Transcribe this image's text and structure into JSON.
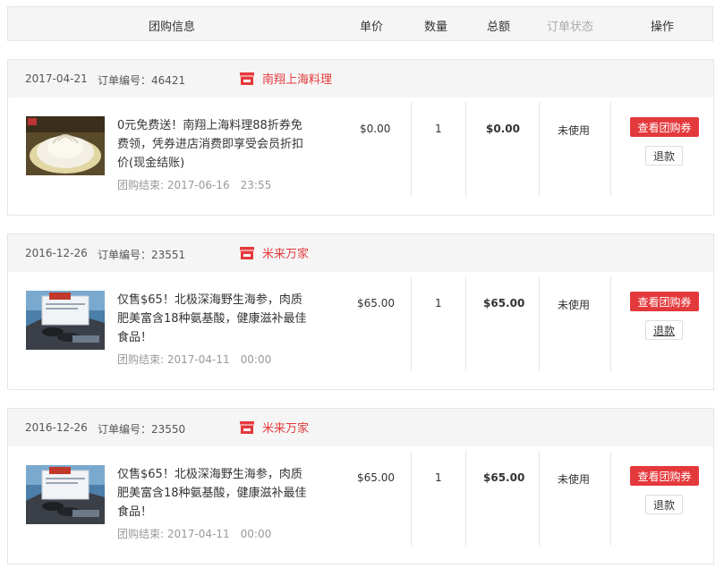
{
  "columns": {
    "info": "团购信息",
    "unit_price": "单价",
    "quantity": "数量",
    "total": "总额",
    "status": "订单状态",
    "actions": "操作"
  },
  "colors": {
    "accent": "#e4393c",
    "header_bg": "#f5f5f5",
    "border": "#e5e5e5"
  },
  "orders": [
    {
      "date": "2017-04-21",
      "order_no": "订单编号：46421",
      "store_icon": "store-icon",
      "store_name": "南翔上海料理",
      "thumb_icon": "dumpling-image",
      "title": "0元免费送！南翔上海料理88折券免费领，凭券进店消费即享受会员折扣价(现金结账)",
      "deadline_label": "团购结束:",
      "deadline_date": "2017-06-16",
      "deadline_time": "23:55",
      "unit_price": "$0.00",
      "quantity": "1",
      "total": "$0.00",
      "status": "未使用",
      "view_button": "查看团购券",
      "refund_button": "退款"
    },
    {
      "date": "2016-12-26",
      "order_no": "订单编号：23551",
      "store_icon": "store-icon",
      "store_name": "米来万家",
      "thumb_icon": "sea-cucumber-image",
      "title": "仅售$65！北极深海野生海参，肉质肥美富含18种氨基酸，健康滋补最佳食品！",
      "deadline_label": "团购结束:",
      "deadline_date": "2017-04-11",
      "deadline_time": "00:00",
      "unit_price": "$65.00",
      "quantity": "1",
      "total": "$65.00",
      "status": "未使用",
      "view_button": "查看团购券",
      "refund_button": "退款"
    },
    {
      "date": "2016-12-26",
      "order_no": "订单编号：23550",
      "store_icon": "store-icon",
      "store_name": "米来万家",
      "thumb_icon": "sea-cucumber-image",
      "title": "仅售$65！北极深海野生海参，肉质肥美富含18种氨基酸，健康滋补最佳食品！",
      "deadline_label": "团购结束:",
      "deadline_date": "2017-04-11",
      "deadline_time": "00:00",
      "unit_price": "$65.00",
      "quantity": "1",
      "total": "$65.00",
      "status": "未使用",
      "view_button": "查看团购券",
      "refund_button": "退款"
    }
  ]
}
